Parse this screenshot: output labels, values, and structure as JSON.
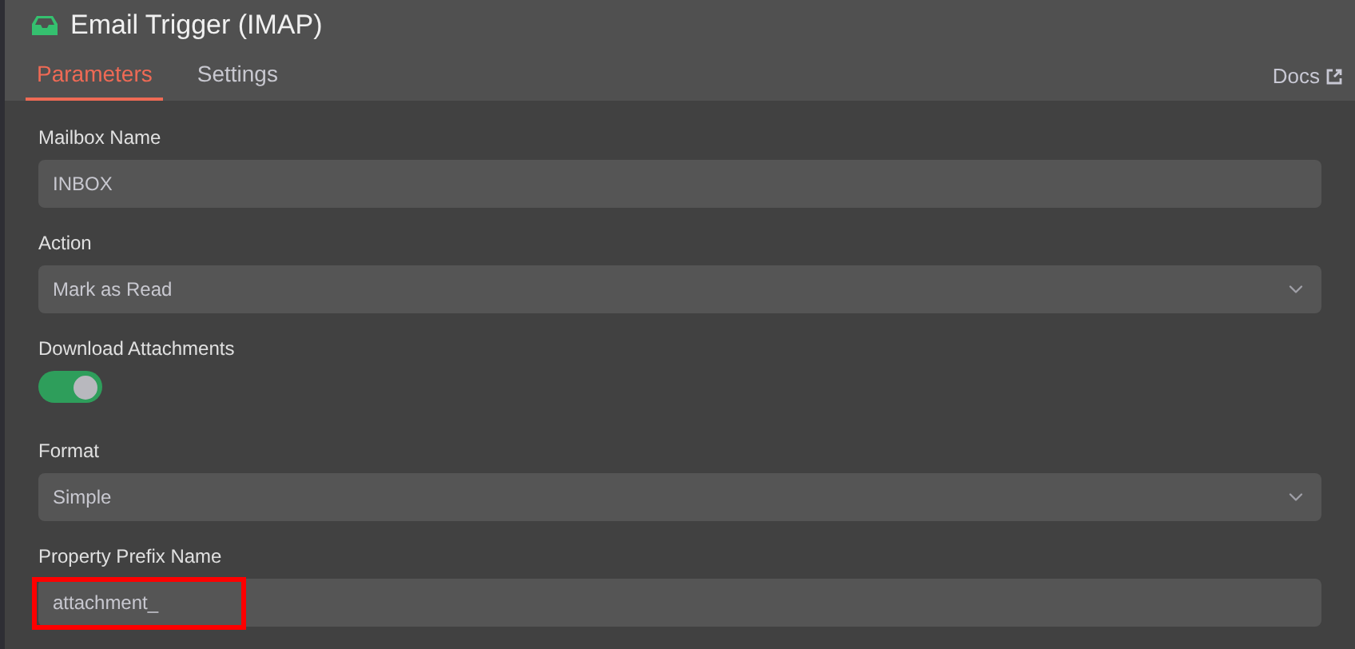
{
  "node": {
    "title": "Email Trigger (IMAP)"
  },
  "tabs": [
    {
      "label": "Parameters",
      "selected": true
    },
    {
      "label": "Settings",
      "selected": false
    }
  ],
  "docs_link": "Docs",
  "fields": [
    {
      "kind": "text",
      "label": "Mailbox Name",
      "value": "INBOX"
    },
    {
      "kind": "select",
      "label": "Action",
      "value": "Mark as Read"
    },
    {
      "kind": "toggle",
      "label": "Download Attachments",
      "on": true
    },
    {
      "kind": "select",
      "label": "Format",
      "value": "Simple"
    },
    {
      "kind": "text",
      "label": "Property Prefix Name",
      "value": "attachment_",
      "highlighted": true
    }
  ]
}
